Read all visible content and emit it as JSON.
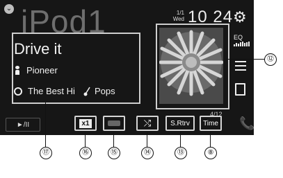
{
  "header": {
    "source_title": "iPod1",
    "date_day": "1/1",
    "date_weekday": "Wed",
    "clock": "10 24"
  },
  "now_playing": {
    "title": "Drive it",
    "artist": "Pioneer",
    "album": "The Best Hi",
    "genre": "Pops",
    "track_count": "4/12"
  },
  "side": {
    "eq_label": "EQ"
  },
  "controls": {
    "play_pause": "►/II",
    "speed": "x1",
    "shuffle_glyph": "⤭",
    "sound_retriever": "S.Rtrv",
    "time": "Time"
  },
  "callouts": [
    "⑫",
    "⑰",
    "⑯",
    "⑮",
    "⑭",
    "⑬",
    "⑧"
  ]
}
